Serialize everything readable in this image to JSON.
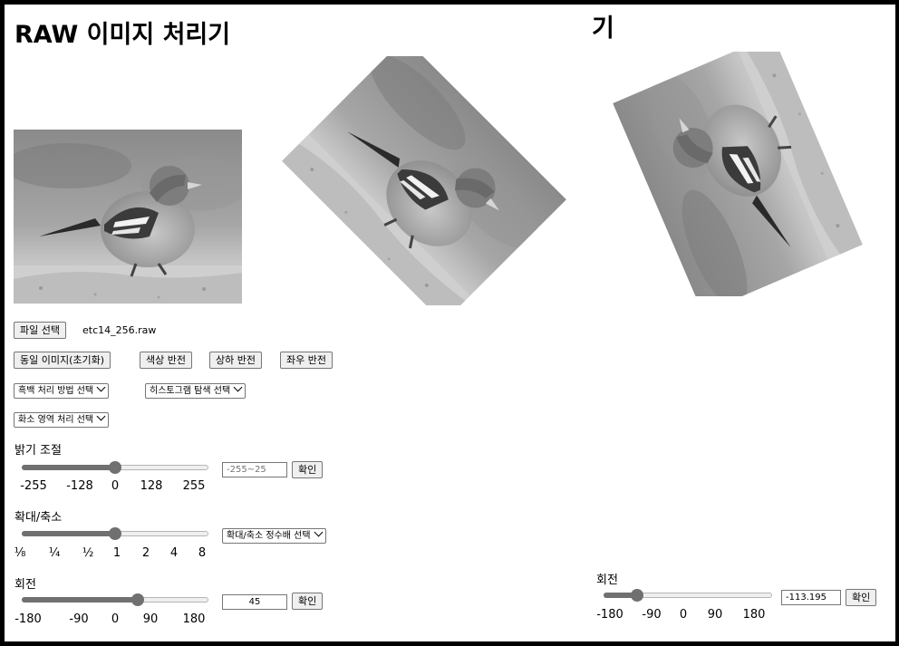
{
  "left": {
    "title": "RAW 이미지 처리기",
    "file_button": "파일 선택",
    "file_name": "etc14_256.raw",
    "buttons": [
      "동일 이미지(초기화)",
      "색상 반전",
      "상하 반전",
      "좌우 반전"
    ],
    "selects_row1": [
      "흑백 처리 방법 선택",
      "히스토그램 탐색 선택"
    ],
    "selects_row2": [
      "화소 영역 처리 선택"
    ],
    "brightness": {
      "label": "밝기 조절",
      "value": 0,
      "min": -255,
      "max": 255,
      "ticks": [
        "-255",
        "-128",
        "0",
        "128",
        "255"
      ],
      "input_placeholder": "-255~25",
      "confirm": "확인"
    },
    "zoom": {
      "label": "확대/축소",
      "value_fraction": 0.5,
      "ticks": [
        "⅛",
        "¼",
        "½",
        "1",
        "2",
        "4",
        "8"
      ],
      "select": "확대/축소 정수배 선택"
    },
    "rotation": {
      "label": "회전",
      "value": 45,
      "min": -180,
      "max": 180,
      "ticks": [
        "-180",
        "-90",
        "0",
        "90",
        "180"
      ],
      "input_value": "45",
      "confirm": "확인"
    },
    "images": {
      "original": "bird-image-original",
      "rotated": "bird-image-rotated-45",
      "rotation_angle": 45
    }
  },
  "right": {
    "title_fragment": "기",
    "rotation": {
      "label": "회전",
      "value": -113.195,
      "min": -180,
      "max": 180,
      "ticks": [
        "-180",
        "-90",
        "0",
        "90",
        "180"
      ],
      "input_value": "-113.195",
      "confirm": "확인"
    },
    "image_rotation_angle": -113.195
  }
}
